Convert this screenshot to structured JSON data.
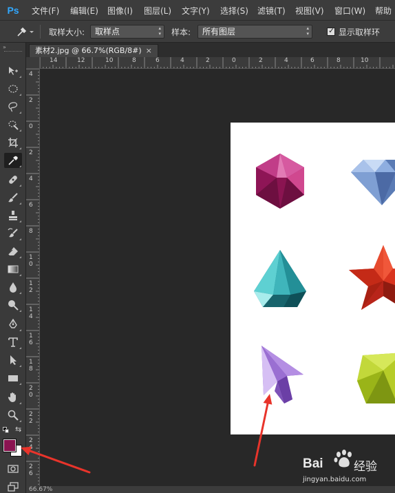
{
  "app": {
    "logo": "Ps"
  },
  "menu": [
    "文件(F)",
    "编辑(E)",
    "图像(I)",
    "图层(L)",
    "文字(Y)",
    "选择(S)",
    "滤镜(T)",
    "视图(V)",
    "窗口(W)",
    "帮助"
  ],
  "options": {
    "sample_size_label": "取样大小:",
    "sample_size_value": "取样点",
    "sample_label": "样本:",
    "sample_value": "所有图层",
    "show_ring_label": "显示取样环",
    "show_ring_checked": true
  },
  "document_tab": {
    "title": "素材2.jpg @ 66.7%(RGB/8#)",
    "close": "×"
  },
  "ruler_top": [
    "14",
    "12",
    "10",
    "8",
    "6",
    "4",
    "2",
    "0",
    "2",
    "4",
    "6",
    "8",
    "10"
  ],
  "ruler_left": [
    "4",
    "2",
    "0",
    "2",
    "4",
    "6",
    "8",
    "10",
    "12",
    "14",
    "16",
    "18",
    "20",
    "22",
    "24",
    "26"
  ],
  "colors": {
    "foreground": "#8a1451",
    "background": "#ffffff",
    "arrow": "#e8342b",
    "accent": "#31a8ff"
  },
  "tools": [
    "move-tool",
    "marquee-tool",
    "lasso-tool",
    "quick-select-tool",
    "crop-tool",
    "eyedropper-tool",
    "healing-brush-tool",
    "brush-tool",
    "clone-stamp-tool",
    "history-brush-tool",
    "eraser-tool",
    "gradient-tool",
    "blur-tool",
    "dodge-tool",
    "pen-tool",
    "type-tool",
    "path-selection-tool",
    "rectangle-tool",
    "hand-tool",
    "zoom-tool"
  ],
  "statusbar": {
    "text": "66.67%"
  },
  "watermark": {
    "brand": "Bai",
    "brand_suffix": "经验",
    "url": "jingyan.baidu.com"
  }
}
